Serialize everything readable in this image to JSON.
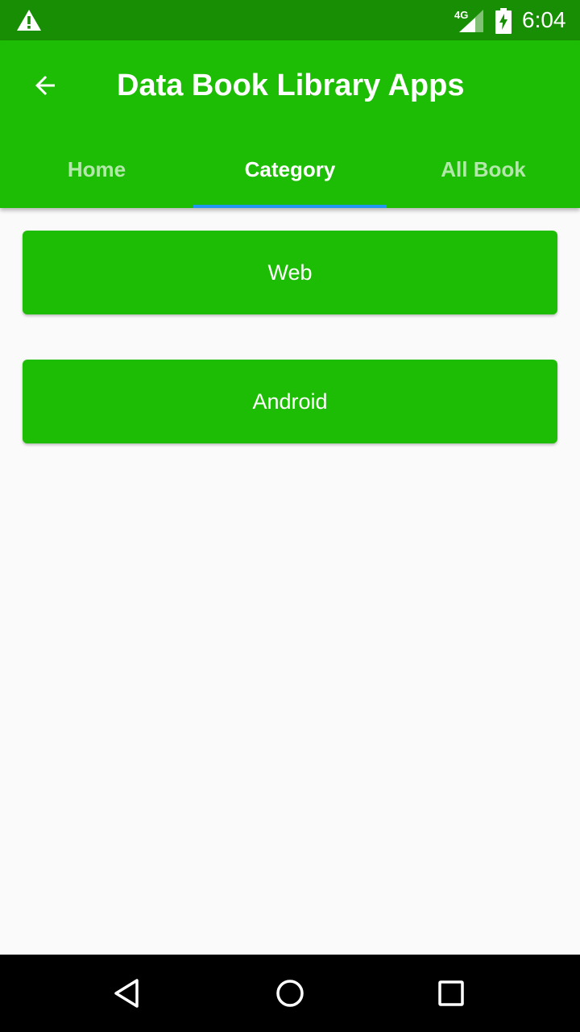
{
  "status_bar": {
    "network": "4G",
    "time": "6:04",
    "icons": [
      "warning-icon",
      "signal-icon",
      "battery-charging-icon"
    ]
  },
  "app_bar": {
    "title": "Data Book Library Apps",
    "back_icon": "arrow-back-icon",
    "color": "#1ebd05"
  },
  "tabs": [
    {
      "label": "Home",
      "active": false
    },
    {
      "label": "Category",
      "active": true
    },
    {
      "label": "All Book",
      "active": false
    }
  ],
  "categories": [
    {
      "label": "Web"
    },
    {
      "label": "Android"
    }
  ],
  "colors": {
    "status_bar": "#188e05",
    "primary": "#1ebd05",
    "tab_indicator": "#2196f3",
    "background": "#fafafa"
  },
  "nav_bar": {
    "icons": [
      "back-triangle-icon",
      "home-circle-icon",
      "recents-square-icon"
    ]
  }
}
